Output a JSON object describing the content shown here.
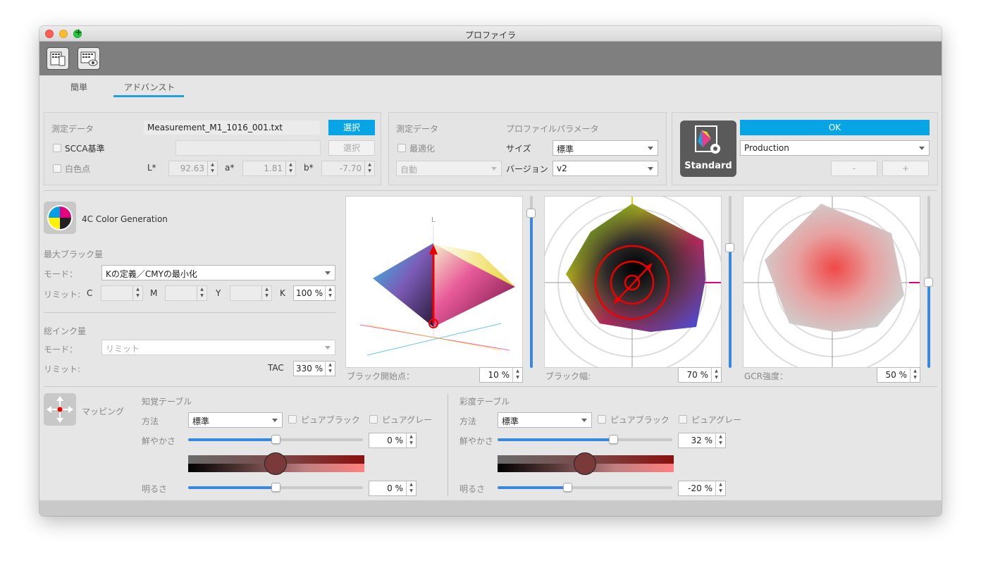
{
  "window": {
    "title": "プロファイラ"
  },
  "tabs": [
    {
      "label": "簡単"
    },
    {
      "label": "アドバンスト"
    }
  ],
  "measurement": {
    "label": "測定データ",
    "filename": "Measurement_M1_1016_001.txt",
    "select_button": "選択",
    "scca_label": "SCCA基準",
    "scca_select_button": "選択",
    "whitepoint_label": "白色点",
    "L_label": "L*",
    "L_value": "92.63",
    "a_label": "a*",
    "a_value": "1.81",
    "b_label": "b*",
    "b_value": "-7.70"
  },
  "profile_params": {
    "measurement_label": "測定データ",
    "params_label": "プロファイルパラメータ",
    "optimize_label": "最適化",
    "size_label": "サイズ",
    "size_value": "標準",
    "auto_value": "自動",
    "version_label": "バージョン",
    "version_value": "v2"
  },
  "preset": {
    "icon_caption": "Standard",
    "ok_button": "OK",
    "preset_value": "Production",
    "minus": "-",
    "plus": "+"
  },
  "color_gen": {
    "title": "4C Color Generation",
    "max_black": "最大ブラック量",
    "mode_label": "モード：",
    "mode_value": "Kの定義／CMYの最小化",
    "limit_label": "リミット:",
    "c": "C",
    "m": "M",
    "y": "Y",
    "k": "K",
    "k_value": "100 %",
    "total_ink": "総インク量",
    "ink_mode_label": "モード：",
    "ink_mode_value": "リミット",
    "ink_limit_label": "リミット:",
    "tac_label": "TAC",
    "tac_value": "330 %"
  },
  "viz": {
    "axis_L": "L",
    "black_start_label": "ブラック開始点：",
    "black_start_value": "10 %",
    "black_width_label": "ブラック幅:",
    "black_width_value": "70 %",
    "gcr_label": "GCR強度：",
    "gcr_value": "50 %",
    "black_start_level": 0.9,
    "black_width_level": 0.7,
    "gcr_level": 0.5
  },
  "mapping": {
    "label": "マッピング",
    "perceptual": {
      "title": "知覚テーブル",
      "method_label": "方法",
      "method_value": "標準",
      "pure_black": "ピュアブラック",
      "pure_gray": "ピュアグレー",
      "vivid_label": "鮮やかさ",
      "vivid_value": "0 %",
      "bright_label": "明るさ",
      "bright_value": "0 %",
      "vivid_level": 0.5,
      "bright_level": 0.5
    },
    "saturation": {
      "title": "彩度テーブル",
      "method_label": "方法",
      "method_value": "標準",
      "pure_black": "ピュアブラック",
      "pure_gray": "ピュアグレー",
      "vivid_label": "鮮やかさ",
      "vivid_value": "32 %",
      "bright_label": "明るさ",
      "bright_value": "-20 %",
      "vivid_level": 0.66,
      "bright_level": 0.4
    }
  },
  "colors": {
    "accent": "#08a5e6",
    "slider": "#3a87e0",
    "toolbar": "#7f7f7f"
  }
}
